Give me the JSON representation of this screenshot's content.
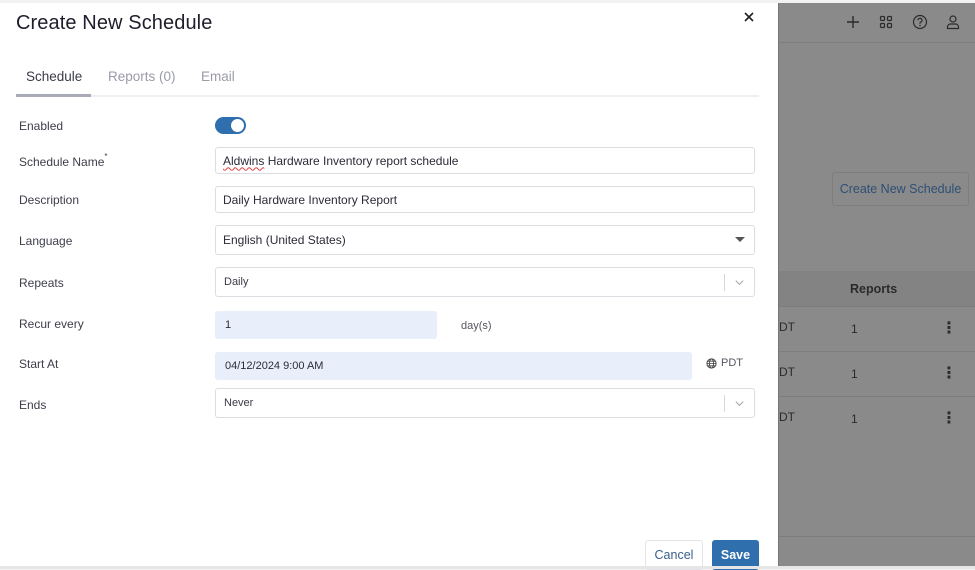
{
  "modal": {
    "title": "Create New Schedule",
    "close_icon": "close-icon",
    "tabs": [
      {
        "label": "Schedule",
        "active": true
      },
      {
        "label": "Reports (0)",
        "active": false
      },
      {
        "label": "Email",
        "active": false
      }
    ],
    "form": {
      "enabled": {
        "label": "Enabled",
        "value": true
      },
      "schedule_name": {
        "label": "Schedule Name",
        "required_marker": "*",
        "value": "Aldwins Hardware Inventory report schedule",
        "misspelled_word": "Aldwins",
        "rest": " Hardware Inventory report schedule"
      },
      "description": {
        "label": "Description",
        "value": "Daily Hardware Inventory Report"
      },
      "language": {
        "label": "Language",
        "value": "English (United States)"
      },
      "repeats": {
        "label": "Repeats",
        "value": "Daily"
      },
      "recur_every": {
        "label": "Recur every",
        "value": "1",
        "unit": "day(s)"
      },
      "start_at": {
        "label": "Start At",
        "value": "04/12/2024 9:00 AM",
        "timezone": "PDT"
      },
      "ends": {
        "label": "Ends",
        "value": "Never"
      }
    },
    "buttons": {
      "cancel": "Cancel",
      "save": "Save"
    }
  },
  "background_page": {
    "topbar_icons": [
      "plus-icon",
      "apps-grid-icon",
      "help-icon",
      "user-icon"
    ],
    "create_button": "Create New Schedule",
    "table": {
      "visible_header": "Reports",
      "rows": [
        {
          "truncated_text": "DT",
          "reports": "1"
        },
        {
          "truncated_text": "DT",
          "reports": "1"
        },
        {
          "truncated_text": "DT",
          "reports": "1"
        }
      ]
    }
  },
  "colors": {
    "accent": "#2f6fad",
    "input_highlight": "#e8effb",
    "backdrop": "#8a8a8a"
  }
}
